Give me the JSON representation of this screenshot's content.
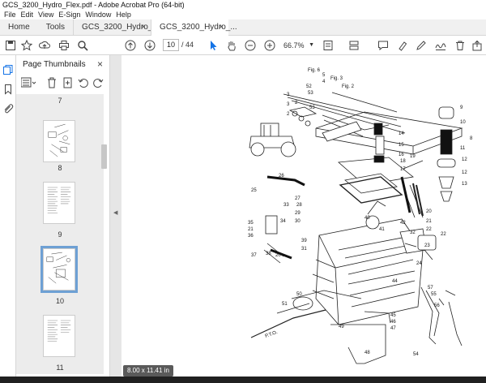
{
  "window": {
    "title": "GCS_3200_Hydro_Flex.pdf - Adobe Acrobat Pro (64-bit)"
  },
  "menu": [
    "File",
    "Edit",
    "View",
    "E-Sign",
    "Window",
    "Help"
  ],
  "tabs": [
    {
      "label": "Home"
    },
    {
      "label": "Tools"
    },
    {
      "label": "GCS_3200_Hydro_...",
      "close": "×"
    },
    {
      "label": "GCS_3200_Hydro_...",
      "close": "×"
    }
  ],
  "toolbar": {
    "page_current": "10",
    "page_total": "/ 44",
    "zoom": "66.7%"
  },
  "thumbnails": {
    "title": "Page Thumbnails",
    "close": "×",
    "pages": [
      {
        "label": "7"
      },
      {
        "label": "8"
      },
      {
        "label": "9"
      },
      {
        "label": "10",
        "selected": true
      },
      {
        "label": "11"
      }
    ]
  },
  "page_size": "8.00 x 11.41 in",
  "drawing": {
    "labels": [
      "Fig. 6",
      "5",
      "Fig. 3",
      "4",
      "Fig. 2",
      "53",
      "52",
      "3",
      "3",
      "2",
      "53",
      "2",
      "9",
      "10",
      "8",
      "11",
      "12",
      "12",
      "13",
      "14",
      "15",
      "16",
      "17",
      "18",
      "19",
      "26",
      "25",
      "27",
      "28",
      "29",
      "30",
      "35",
      "21",
      "36",
      "38",
      "39",
      "31",
      "20",
      "37",
      "34",
      "33",
      "32",
      "22",
      "40",
      "42",
      "41",
      "20",
      "21",
      "22",
      "23",
      "24",
      "44",
      "50",
      "51",
      "45",
      "46",
      "47",
      "49",
      "48",
      "54",
      "55",
      "56",
      "57",
      "P.T.O."
    ]
  },
  "colors": {
    "accent": "#1473e6",
    "selection": "#6ea0d4"
  }
}
